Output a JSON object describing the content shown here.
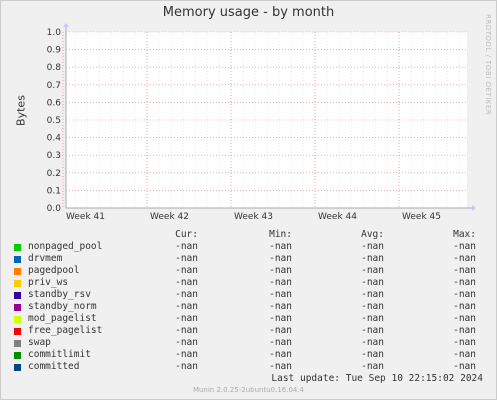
{
  "title": "Memory usage - by month",
  "watermark": "RRDTOOL / TOBI OETIKER",
  "chart_data": {
    "type": "line",
    "ylabel": "Bytes",
    "ylim": [
      0.0,
      1.0
    ],
    "yticks": [
      "0.0",
      "0.1",
      "0.2",
      "0.3",
      "0.4",
      "0.5",
      "0.6",
      "0.7",
      "0.8",
      "0.9",
      "1.0"
    ],
    "xticks": [
      "Week 41",
      "Week 42",
      "Week 43",
      "Week 44",
      "Week 45"
    ],
    "grid": true,
    "series": [
      {
        "name": "nonpaged_pool",
        "values": []
      },
      {
        "name": "drvmem",
        "values": []
      },
      {
        "name": "pagedpool",
        "values": []
      },
      {
        "name": "priv_ws",
        "values": []
      },
      {
        "name": "standby_rsv",
        "values": []
      },
      {
        "name": "standby_norm",
        "values": []
      },
      {
        "name": "mod_pagelist",
        "values": []
      },
      {
        "name": "free_pagelist",
        "values": []
      },
      {
        "name": "swap",
        "values": []
      },
      {
        "name": "commitlimit",
        "values": []
      },
      {
        "name": "committed",
        "values": []
      }
    ]
  },
  "legend": {
    "headers": {
      "cur": "Cur:",
      "min": "Min:",
      "avg": "Avg:",
      "max": "Max:"
    },
    "rows": [
      {
        "name": "nonpaged_pool",
        "color": "#00cc00",
        "cur": "-nan",
        "min": "-nan",
        "avg": "-nan",
        "max": "-nan"
      },
      {
        "name": "drvmem",
        "color": "#0066b3",
        "cur": "-nan",
        "min": "-nan",
        "avg": "-nan",
        "max": "-nan"
      },
      {
        "name": "pagedpool",
        "color": "#ff8000",
        "cur": "-nan",
        "min": "-nan",
        "avg": "-nan",
        "max": "-nan"
      },
      {
        "name": "priv_ws",
        "color": "#ffcc00",
        "cur": "-nan",
        "min": "-nan",
        "avg": "-nan",
        "max": "-nan"
      },
      {
        "name": "standby_rsv",
        "color": "#330099",
        "cur": "-nan",
        "min": "-nan",
        "avg": "-nan",
        "max": "-nan"
      },
      {
        "name": "standby_norm",
        "color": "#990099",
        "cur": "-nan",
        "min": "-nan",
        "avg": "-nan",
        "max": "-nan"
      },
      {
        "name": "mod_pagelist",
        "color": "#ccff00",
        "cur": "-nan",
        "min": "-nan",
        "avg": "-nan",
        "max": "-nan"
      },
      {
        "name": "free_pagelist",
        "color": "#ff0000",
        "cur": "-nan",
        "min": "-nan",
        "avg": "-nan",
        "max": "-nan"
      },
      {
        "name": "swap",
        "color": "#808080",
        "cur": "-nan",
        "min": "-nan",
        "avg": "-nan",
        "max": "-nan"
      },
      {
        "name": "commitlimit",
        "color": "#008f00",
        "cur": "-nan",
        "min": "-nan",
        "avg": "-nan",
        "max": "-nan"
      },
      {
        "name": "committed",
        "color": "#00487d",
        "cur": "-nan",
        "min": "-nan",
        "avg": "-nan",
        "max": "-nan"
      }
    ]
  },
  "last_update": "Last update:  Tue Sep 10 22:15:02 2024",
  "footer": "Munin 2.0.25-2ubuntu0.16.04.4",
  "colors": {
    "grid_major": "#e08080",
    "grid_minor": "#d0d0d0",
    "plot_bg": "#ffffff",
    "axis": "#aaaaaa"
  }
}
